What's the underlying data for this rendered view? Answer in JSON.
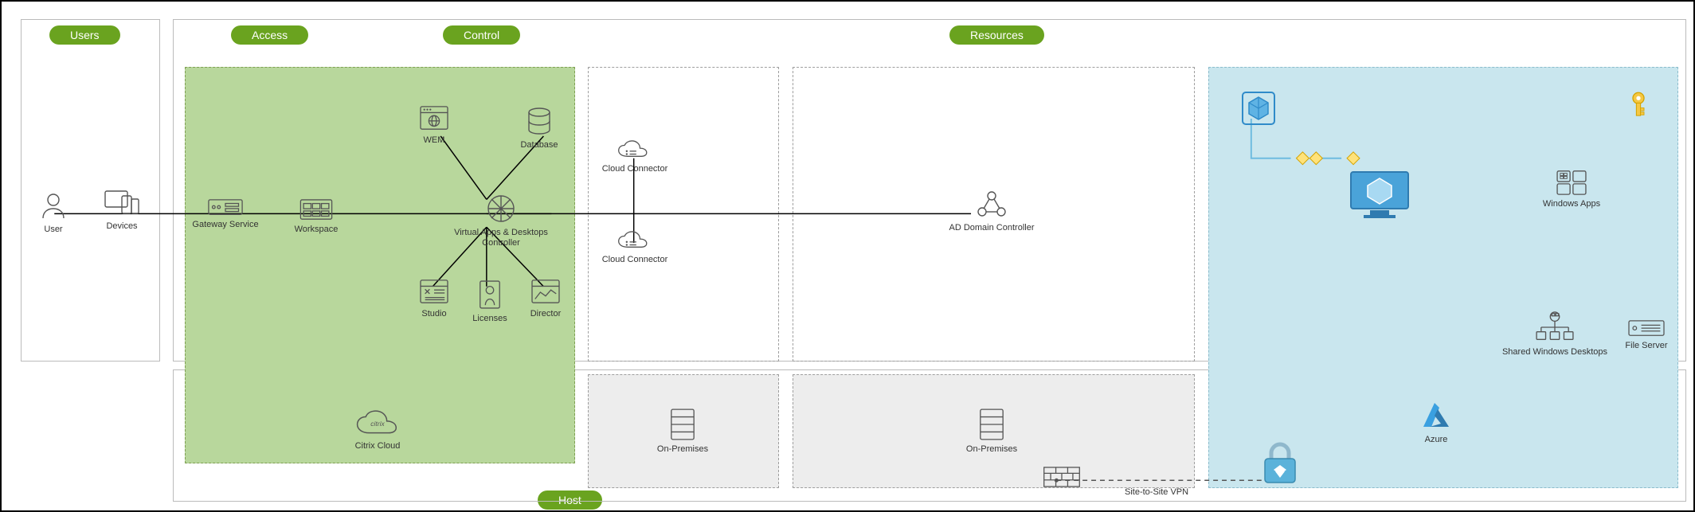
{
  "columns": {
    "users": "Users",
    "access": "Access",
    "control": "Control",
    "resources": "Resources",
    "host": "Host"
  },
  "users": {
    "user": "User",
    "devices": "Devices"
  },
  "access": {
    "gateway": "Gateway Service",
    "workspace": "Workspace",
    "controller": "Virtual Apps & Desktops Controller",
    "wem": "WEM",
    "database": "Database",
    "studio": "Studio",
    "licenses": "Licenses",
    "director": "Director",
    "citrix_cloud": "Citrix Cloud"
  },
  "control": {
    "cc1": "Cloud Connector",
    "cc2": "Cloud Connector",
    "onprem": "On-Premises"
  },
  "resources": {
    "adc": "AD Domain Controller",
    "onprem": "On-Premises",
    "vpn": "Site-to-Site VPN"
  },
  "azure": {
    "winapps": "Windows Apps",
    "desktops": "Shared Windows Desktops",
    "fileserver": "File Server",
    "azure": "Azure"
  }
}
